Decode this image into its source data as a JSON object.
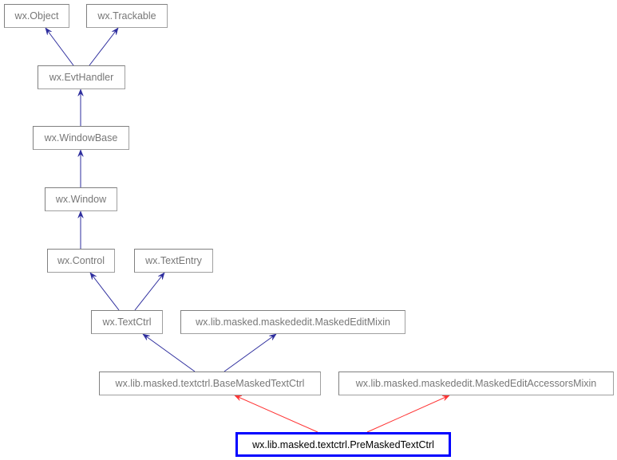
{
  "diagram": {
    "type": "class-inheritance-graph",
    "colors": {
      "inherit_edge": "#2e2e9e",
      "focus_edge": "#ff3333",
      "focus_border": "#0000ff",
      "node_border": "#808080",
      "node_text": "#777777",
      "focus_text": "#000000"
    },
    "nodes": [
      {
        "id": "object",
        "label": "wx.Object"
      },
      {
        "id": "trackable",
        "label": "wx.Trackable"
      },
      {
        "id": "evthandler",
        "label": "wx.EvtHandler"
      },
      {
        "id": "windowbase",
        "label": "wx.WindowBase"
      },
      {
        "id": "window",
        "label": "wx.Window"
      },
      {
        "id": "control",
        "label": "wx.Control"
      },
      {
        "id": "textentry",
        "label": "wx.TextEntry"
      },
      {
        "id": "textctrl",
        "label": "wx.TextCtrl"
      },
      {
        "id": "maskededitmixin",
        "label": "wx.lib.masked.maskededit.MaskedEditMixin"
      },
      {
        "id": "basemaskedtextctrl",
        "label": "wx.lib.masked.textctrl.BaseMaskedTextCtrl"
      },
      {
        "id": "accessorsmixin",
        "label": "wx.lib.masked.maskededit.MaskedEditAccessorsMixin"
      },
      {
        "id": "premaskedtextctrl",
        "label": "wx.lib.masked.textctrl.PreMaskedTextCtrl",
        "focus": true
      }
    ],
    "edges": [
      {
        "from": "evthandler",
        "to": "object",
        "kind": "inherit"
      },
      {
        "from": "evthandler",
        "to": "trackable",
        "kind": "inherit"
      },
      {
        "from": "windowbase",
        "to": "evthandler",
        "kind": "inherit"
      },
      {
        "from": "window",
        "to": "windowbase",
        "kind": "inherit"
      },
      {
        "from": "control",
        "to": "window",
        "kind": "inherit"
      },
      {
        "from": "textctrl",
        "to": "control",
        "kind": "inherit"
      },
      {
        "from": "textctrl",
        "to": "textentry",
        "kind": "inherit"
      },
      {
        "from": "basemaskedtextctrl",
        "to": "textctrl",
        "kind": "inherit"
      },
      {
        "from": "basemaskedtextctrl",
        "to": "maskededitmixin",
        "kind": "inherit"
      },
      {
        "from": "premaskedtextctrl",
        "to": "basemaskedtextctrl",
        "kind": "focus"
      },
      {
        "from": "premaskedtextctrl",
        "to": "accessorsmixin",
        "kind": "focus"
      }
    ]
  }
}
